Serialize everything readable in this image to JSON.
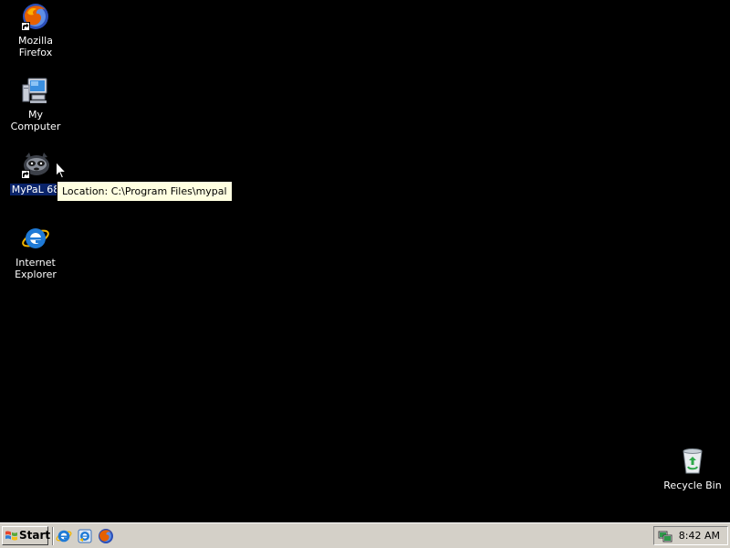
{
  "desktop": {
    "icons": [
      {
        "label": "Mozilla Firefox",
        "icon": "firefox-icon",
        "shortcut": true
      },
      {
        "label": "My Computer",
        "icon": "my-computer-icon",
        "shortcut": false
      },
      {
        "label": "MyPaL 68",
        "icon": "mypal-icon",
        "shortcut": true,
        "selected": true
      },
      {
        "label": "Internet Explorer",
        "icon": "internet-explorer-icon",
        "shortcut": false
      },
      {
        "label": "Recycle Bin",
        "icon": "recycle-bin-icon",
        "shortcut": false
      }
    ],
    "background_color": "#000000"
  },
  "tooltip": {
    "text": "Location: C:\\Program Files\\mypal"
  },
  "taskbar": {
    "start_label": "Start",
    "quick_launch": [
      {
        "icon": "internet-explorer-icon"
      },
      {
        "icon": "outlook-express-icon"
      },
      {
        "icon": "firefox-icon"
      }
    ],
    "clock": "8:42 AM"
  },
  "colors": {
    "taskbar": "#d4d0c8",
    "selection": "#0a246a",
    "tooltip_bg": "#ffffe1"
  }
}
